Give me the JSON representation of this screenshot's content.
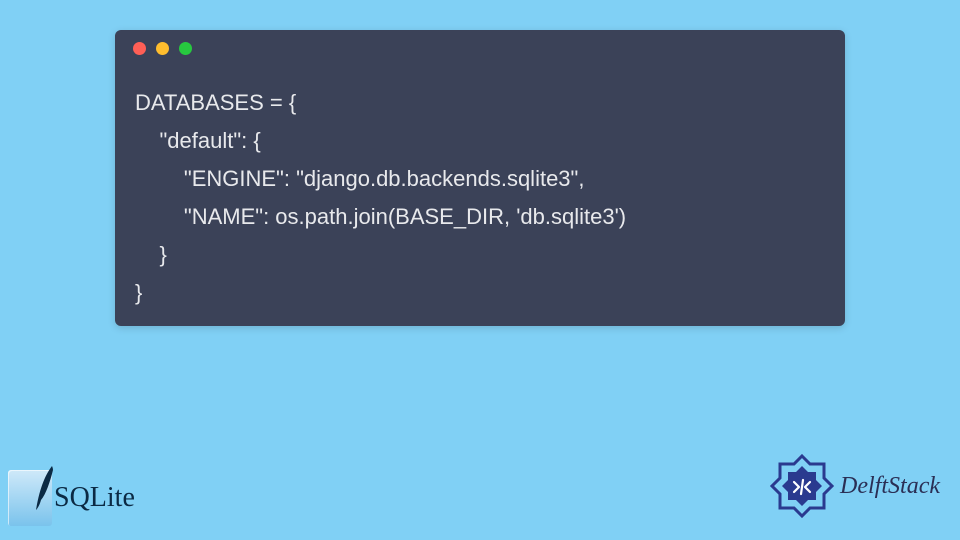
{
  "window": {
    "dot_colors": {
      "red": "#ff5f56",
      "yellow": "#ffbd2e",
      "green": "#27c93f"
    }
  },
  "code": {
    "lines": [
      "DATABASES = {",
      "    \"default\": {",
      "        \"ENGINE\": \"django.db.backends.sqlite3\",",
      "        \"NAME\": os.path.join(BASE_DIR, 'db.sqlite3')",
      "    }",
      "}"
    ]
  },
  "logos": {
    "sqlite_text": "SQLite",
    "delft_text": "DelftStack"
  }
}
